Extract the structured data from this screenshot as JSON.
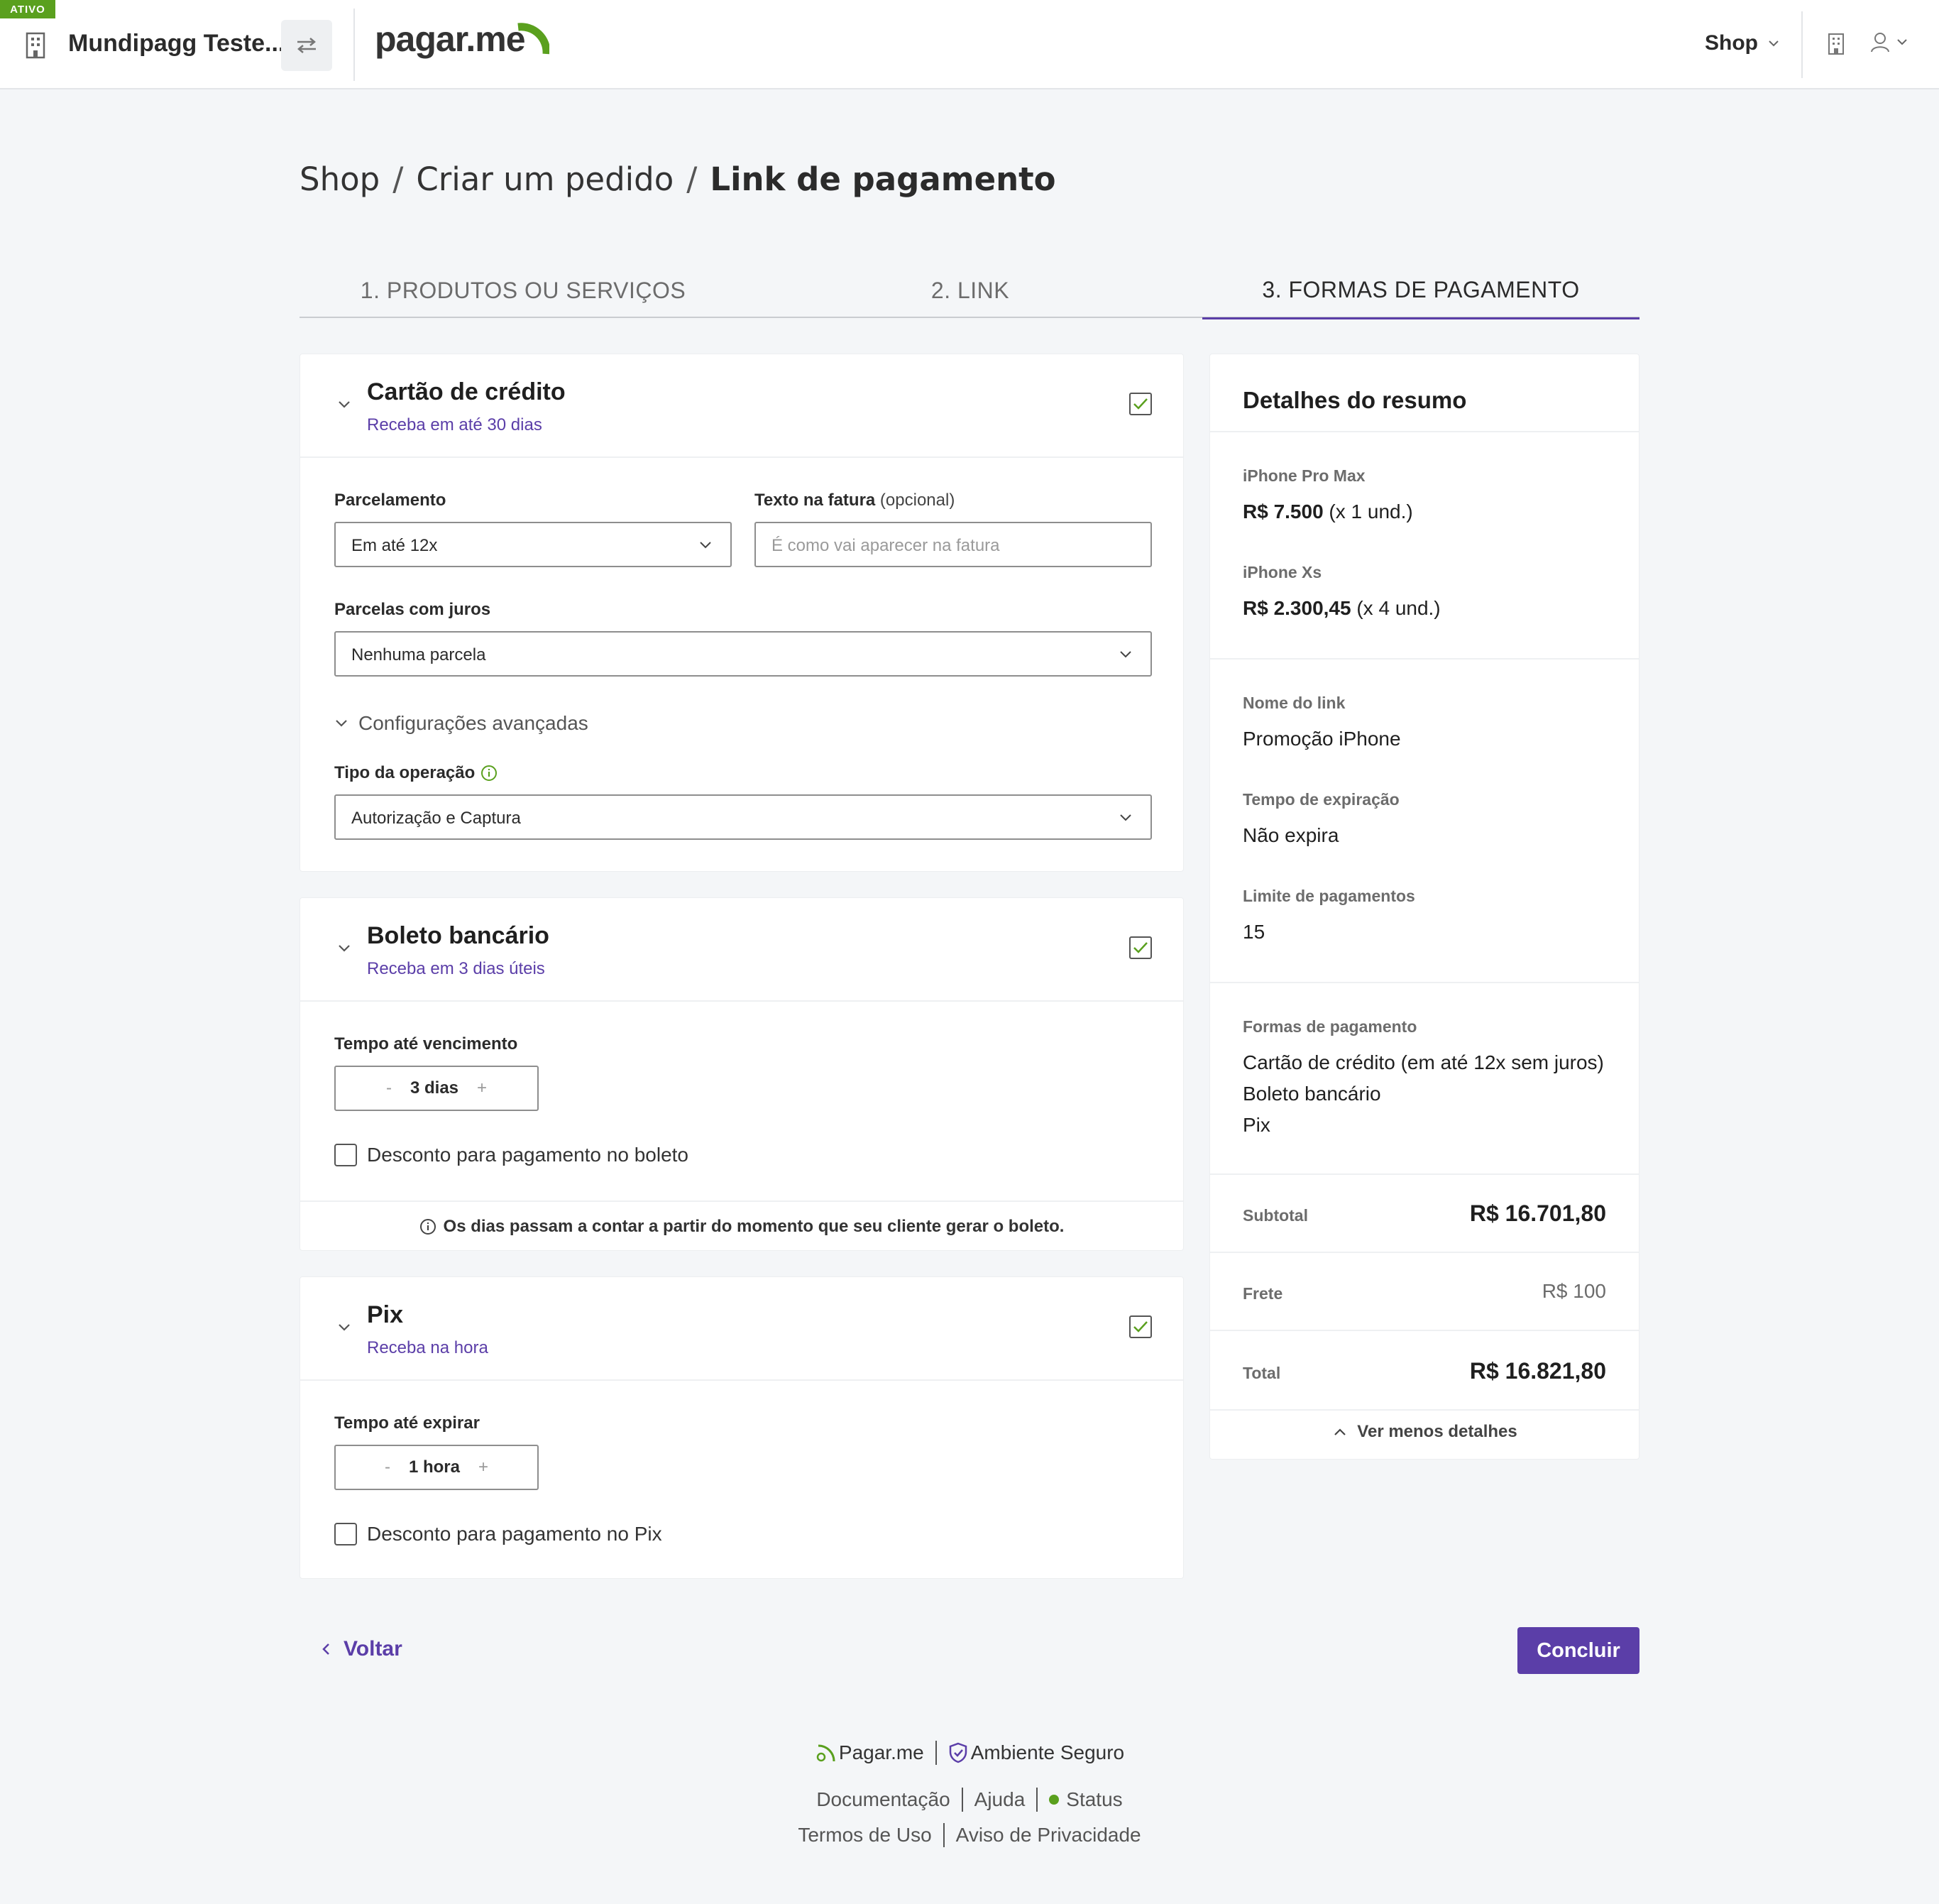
{
  "header": {
    "status_badge": "ATIVO",
    "company_name": "Mundipagg Teste...",
    "logo_text": "pagar.me",
    "shop_menu": "Shop",
    "accent": "#5b3ea8",
    "green": "#5aa01e"
  },
  "breadcrumb": {
    "items": [
      "Shop",
      "Criar um pedido"
    ],
    "current": "Link de pagamento",
    "separator": "/"
  },
  "steps": [
    {
      "label": "1.  PRODUTOS OU SERVIÇOS",
      "active": false
    },
    {
      "label": "2.  LINK",
      "active": false
    },
    {
      "label": "3.  FORMAS DE PAGAMENTO",
      "active": true
    }
  ],
  "credit_card": {
    "title": "Cartão de crédito",
    "subtitle": "Receba em até 30 dias",
    "checked": true,
    "installments_label": "Parcelamento",
    "installments_value": "Em até 12x",
    "invoice_label": "Texto na fatura",
    "invoice_optional": "(opcional)",
    "invoice_placeholder": "É como vai aparecer na fatura",
    "interest_label": "Parcelas com juros",
    "interest_value": "Nenhuma parcela",
    "advanced_label": "Configurações avançadas",
    "operation_label": "Tipo da operação",
    "operation_value": "Autorização e Captura"
  },
  "boleto": {
    "title": "Boleto bancário",
    "subtitle": "Receba em 3 dias úteis",
    "checked": true,
    "due_label": "Tempo até vencimento",
    "due_value": "3 dias",
    "minus": "-",
    "plus": "+",
    "discount_label": "Desconto para pagamento no boleto",
    "note": "Os dias passam a contar a partir do momento que seu cliente gerar o boleto."
  },
  "pix": {
    "title": "Pix",
    "subtitle": "Receba na hora",
    "checked": true,
    "expire_label": "Tempo até expirar",
    "expire_value": "1 hora",
    "minus": "-",
    "plus": "+",
    "discount_label": "Desconto para pagamento no Pix"
  },
  "summary": {
    "title": "Detalhes do resumo",
    "products": [
      {
        "name": "iPhone Pro Max",
        "price": "R$ 7.500",
        "qty": " (x 1 und.)"
      },
      {
        "name": "iPhone Xs",
        "price": "R$ 2.300,45",
        "qty": " (x 4 und.)"
      }
    ],
    "link_name_label": "Nome do link",
    "link_name": "Promoção iPhone",
    "expiration_label": "Tempo de expiração",
    "expiration": "Não expira",
    "limit_label": "Limite de pagamentos",
    "limit": "15",
    "methods_label": "Formas de pagamento",
    "methods": [
      "Cartão de crédito (em até 12x sem juros)",
      "Boleto bancário",
      "Pix"
    ],
    "subtotal_label": "Subtotal",
    "subtotal": "R$ 16.701,80",
    "shipping_label": "Frete",
    "shipping": "R$ 100",
    "total_label": "Total",
    "total": "R$ 16.821,80",
    "toggle_label": "Ver menos detalhes"
  },
  "actions": {
    "back": "Voltar",
    "finish": "Concluir"
  },
  "footer": {
    "brand": "Pagar.me",
    "secure": "Ambiente Seguro",
    "docs": "Documentação",
    "help": "Ajuda",
    "status": "Status",
    "terms": "Termos de Uso",
    "privacy": "Aviso de Privacidade"
  }
}
